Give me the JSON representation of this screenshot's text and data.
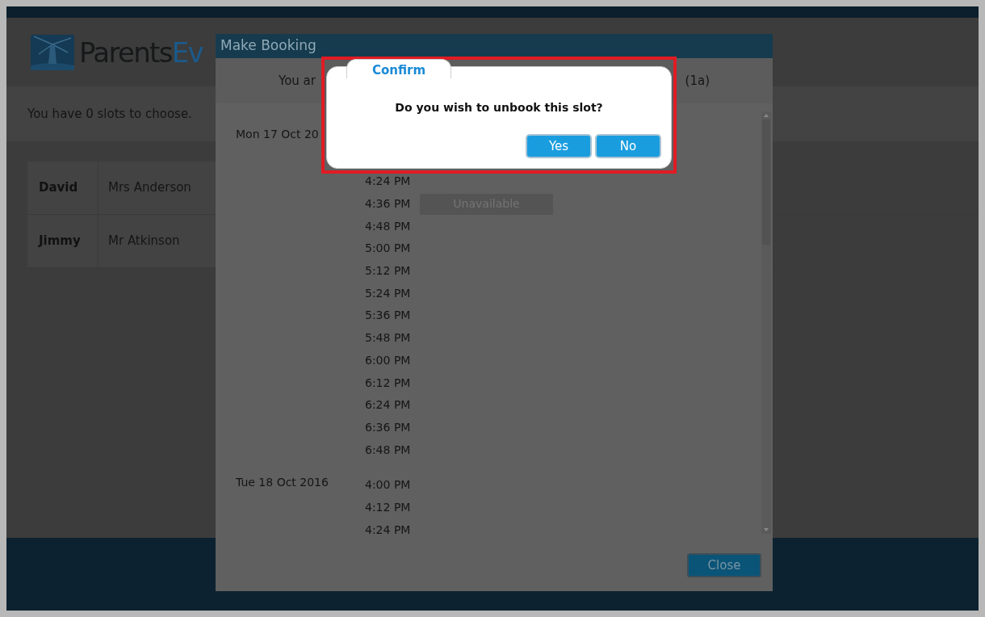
{
  "logo": {
    "text_main": "Parents",
    "text_accent": "Ev"
  },
  "slots_message": "You have 0 slots to choose.",
  "students": [
    {
      "name": "David",
      "teacher": "Mrs Anderson"
    },
    {
      "name": "Jimmy",
      "teacher": "Mr Atkinson"
    }
  ],
  "booking_dialog": {
    "title": "Make Booking",
    "subtitle_start": "You ar",
    "subtitle_end": "(1a)",
    "days": [
      {
        "date": "Mon 17 Oct 20",
        "slots": [
          {
            "time": "4:24 PM"
          },
          {
            "time": "4:36 PM",
            "status": "Unavailable"
          },
          {
            "time": "4:48 PM"
          },
          {
            "time": "5:00 PM"
          },
          {
            "time": "5:12 PM"
          },
          {
            "time": "5:24 PM"
          },
          {
            "time": "5:36 PM"
          },
          {
            "time": "5:48 PM"
          },
          {
            "time": "6:00 PM"
          },
          {
            "time": "6:12 PM"
          },
          {
            "time": "6:24 PM"
          },
          {
            "time": "6:36 PM"
          },
          {
            "time": "6:48 PM"
          }
        ]
      },
      {
        "date": "Tue 18 Oct 2016",
        "slots": [
          {
            "time": "4:00 PM"
          },
          {
            "time": "4:12 PM"
          },
          {
            "time": "4:24 PM"
          }
        ]
      }
    ],
    "close_button": "Close"
  },
  "confirm_dialog": {
    "tab": "Confirm",
    "message": "Do you wish to unbook this slot?",
    "buttons": [
      "Yes",
      "No"
    ],
    "highlighted": true
  }
}
